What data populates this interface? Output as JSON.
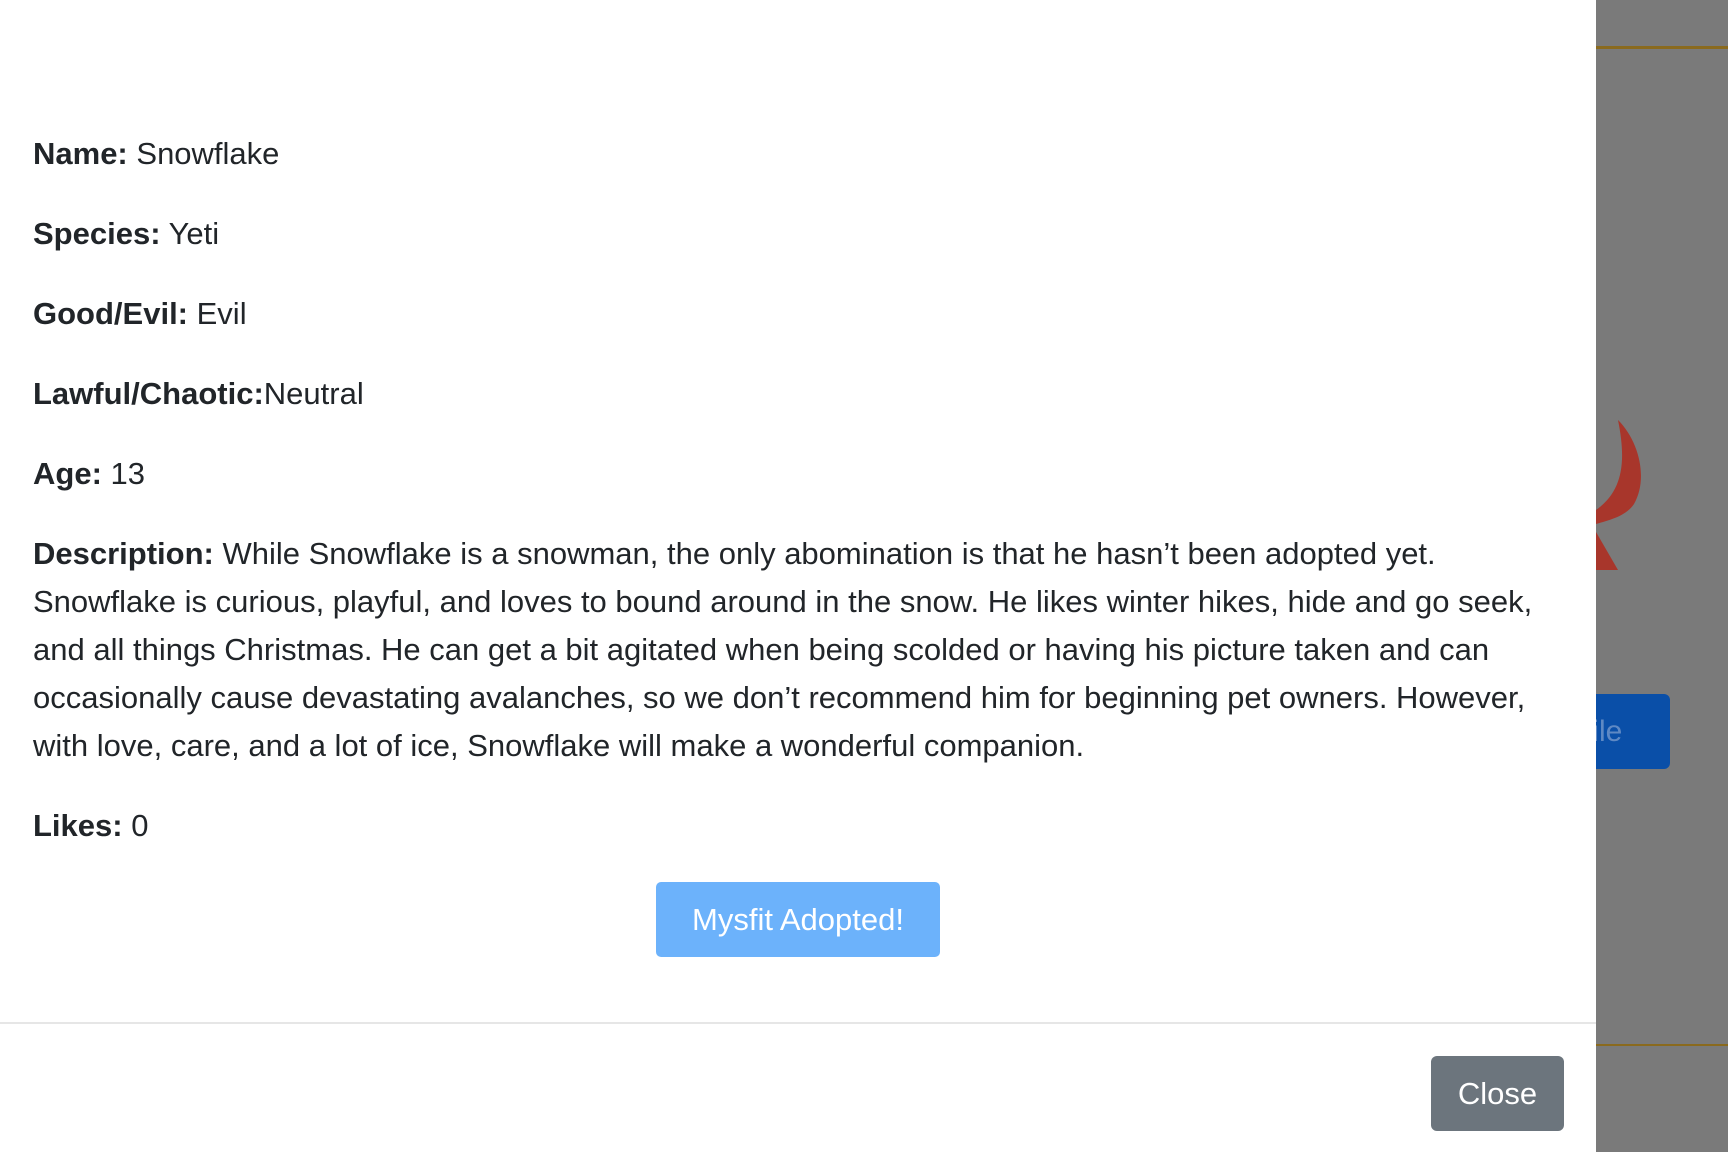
{
  "modal": {
    "fields": {
      "name": {
        "label": "Name:",
        "value": "Snowflake"
      },
      "species": {
        "label": "Species:",
        "value": "Yeti"
      },
      "good_evil": {
        "label": "Good/Evil:",
        "value": "Evil"
      },
      "lawful_chaotic": {
        "label": "Lawful/Chaotic:",
        "value": "Neutral"
      },
      "age": {
        "label": "Age:",
        "value": "13"
      },
      "description": {
        "label": "Description:",
        "value": "While Snowflake is a snowman, the only abomination is that he hasn’t been adopted yet. Snowflake is curious, playful, and loves to bound around in the snow. He likes winter hikes, hide and go seek, and all things Christmas. He can get a bit agitated when being scolded or having his picture taken and can occasionally cause devastating avalanches, so we don’t recommend him for beginning pet owners. However, with love, care, and a lot of ice, Snowflake will make a wonderful companion."
      },
      "likes": {
        "label": "Likes:",
        "value": "0"
      }
    },
    "adopt_button_label": "Mysfit Adopted!",
    "close_button_label": "Close"
  },
  "background": {
    "profile_button_label_partial": "file"
  },
  "colors": {
    "adopt_button": "#6cb2fb",
    "close_button": "#6c757d",
    "overlay": "#7b7b7b",
    "background_button": "#0a4fa8",
    "accent_rule": "#8a6a1e"
  }
}
